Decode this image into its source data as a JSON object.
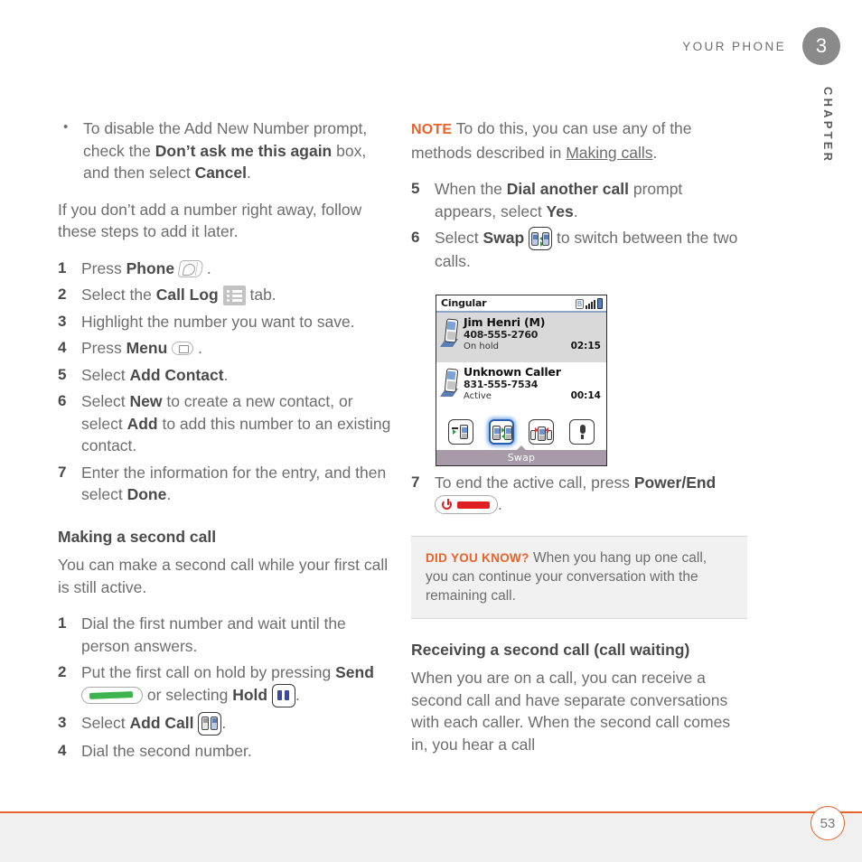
{
  "header": {
    "running_title": "YOUR PHONE",
    "chapter_number": "3",
    "chapter_label": "CHAPTER"
  },
  "left_column": {
    "bullet_items": [
      {
        "part1": "To disable the Add New Number prompt, check the ",
        "bold1": "Don’t ask me this again",
        "part2": " box, and then select ",
        "bold2": "Cancel",
        "part3": "."
      }
    ],
    "intro_paragraph": "If you don’t add a number right away, follow these steps to add it later.",
    "steps": [
      {
        "num": "1",
        "pre": "Press ",
        "bold": "Phone",
        "post": " .",
        "icon": "phone-hardware-key-icon"
      },
      {
        "num": "2",
        "pre": "Select the ",
        "bold": "Call Log",
        "post": " tab.",
        "icon": "call-log-tab-icon"
      },
      {
        "num": "3",
        "pre": "Highlight the number you want to save.",
        "bold": "",
        "post": "",
        "icon": ""
      },
      {
        "num": "4",
        "pre": "Press ",
        "bold": "Menu",
        "post": " .",
        "icon": "menu-hardware-key-icon"
      },
      {
        "num": "5",
        "pre": "Select ",
        "bold": "Add Contact",
        "post": ".",
        "icon": ""
      },
      {
        "num": "6",
        "pre": "Select ",
        "bold": "New",
        "post": " to create a new contact, or select ",
        "bold2": "Add",
        "post2": " to add this number to an existing contact.",
        "icon": ""
      },
      {
        "num": "7",
        "pre": "Enter the information for the entry, and then select ",
        "bold": "Done",
        "post": ".",
        "icon": ""
      }
    ],
    "section_heading": "Making a second call",
    "section_paragraph": "You can make a second call while your first call is still active.",
    "steps2": [
      {
        "num": "1",
        "text": "Dial the first number and wait until the person answers."
      },
      {
        "num": "2",
        "pre": "Put the first call on hold by pressing ",
        "bold": "Send",
        "mid": " or selecting ",
        "bold2": "Hold",
        "post": ".",
        "icon1": "send-hardware-key-icon",
        "icon2": "hold-button-icon"
      },
      {
        "num": "3",
        "pre": "Select ",
        "bold": "Add Call",
        "post": ".",
        "icon": "add-call-button-icon"
      },
      {
        "num": "4",
        "text": "Dial the second number."
      }
    ]
  },
  "right_column": {
    "note": {
      "tag": "NOTE",
      "pre": " To do this, you can use any of the methods described in ",
      "link": "Making calls",
      "post": "."
    },
    "steps": [
      {
        "num": "5",
        "pre": "When the ",
        "bold": "Dial another call",
        "mid": " prompt appears, select ",
        "bold2": "Yes",
        "post": "."
      },
      {
        "num": "6",
        "pre": "Select ",
        "bold": "Swap",
        "post": " to switch between the two calls.",
        "icon": "swap-button-icon"
      }
    ],
    "step7": {
      "num": "7",
      "pre": "To end the active call, press ",
      "bold": "Power/End",
      "post": ".",
      "icon": "power-end-hardware-key-icon"
    },
    "did_you_know": {
      "tag": "DID YOU KNOW?",
      "text": " When you hang up one call, you can continue your conversation with the remaining call."
    },
    "section_heading": "Receiving a second call (call waiting)",
    "section_paragraph": "When you are on a call, you can receive a second call and have separate conversations with each caller. When the second call comes in, you hear a call"
  },
  "phone_screenshot": {
    "carrier": "Cingular",
    "status_icons": [
      "bluetooth-icon",
      "signal-strength-icon",
      "battery-icon"
    ],
    "calls": [
      {
        "name": "Jim  Henri (M)",
        "number": "408-555-2760",
        "status": "On hold",
        "duration": "02:15",
        "highlighted": true
      },
      {
        "name": "Unknown Caller",
        "number": "831-555-7534",
        "status": "Active",
        "duration": "00:14",
        "highlighted": false
      }
    ],
    "toolbar_buttons": [
      {
        "name": "transfer-call-button",
        "selected": false
      },
      {
        "name": "swap-call-button",
        "selected": true
      },
      {
        "name": "conference-call-button",
        "selected": false
      },
      {
        "name": "mute-button",
        "selected": false
      }
    ],
    "footer_label": "Swap"
  },
  "footer": {
    "page_number": "53"
  },
  "colors": {
    "accent_orange": "#e8622a",
    "body_gray": "#6d6d6d",
    "bold_gray": "#4a4a4a",
    "chapter_badge": "#8a8a8a"
  }
}
